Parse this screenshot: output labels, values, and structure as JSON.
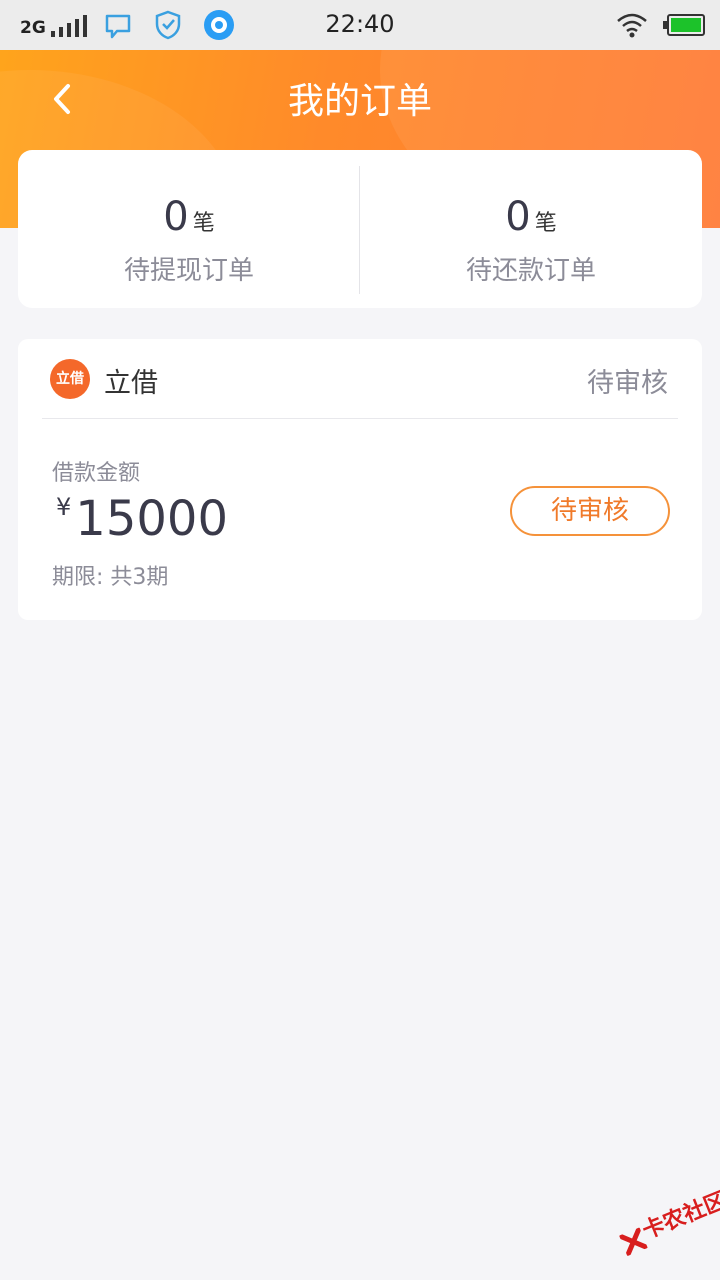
{
  "status_bar": {
    "network": "2G",
    "time": "22:40"
  },
  "header": {
    "title": "我的订单"
  },
  "summary": {
    "pending_withdrawal": {
      "count": "0",
      "unit": "笔",
      "label": "待提现订单"
    },
    "pending_repayment": {
      "count": "0",
      "unit": "笔",
      "label": "待还款订单"
    }
  },
  "order": {
    "lender_logo_text": "立借",
    "lender_name": "立借",
    "status": "待审核",
    "amount_label": "借款金额",
    "currency": "¥",
    "amount": "15000",
    "term": "期限: 共3期",
    "action_label": "待审核"
  },
  "watermark": {
    "text": "卡农社区"
  },
  "colors": {
    "header_start": "#ffa41c",
    "header_end": "#ff7a35",
    "accent": "#f07a2a",
    "background": "#f5f5f8"
  }
}
